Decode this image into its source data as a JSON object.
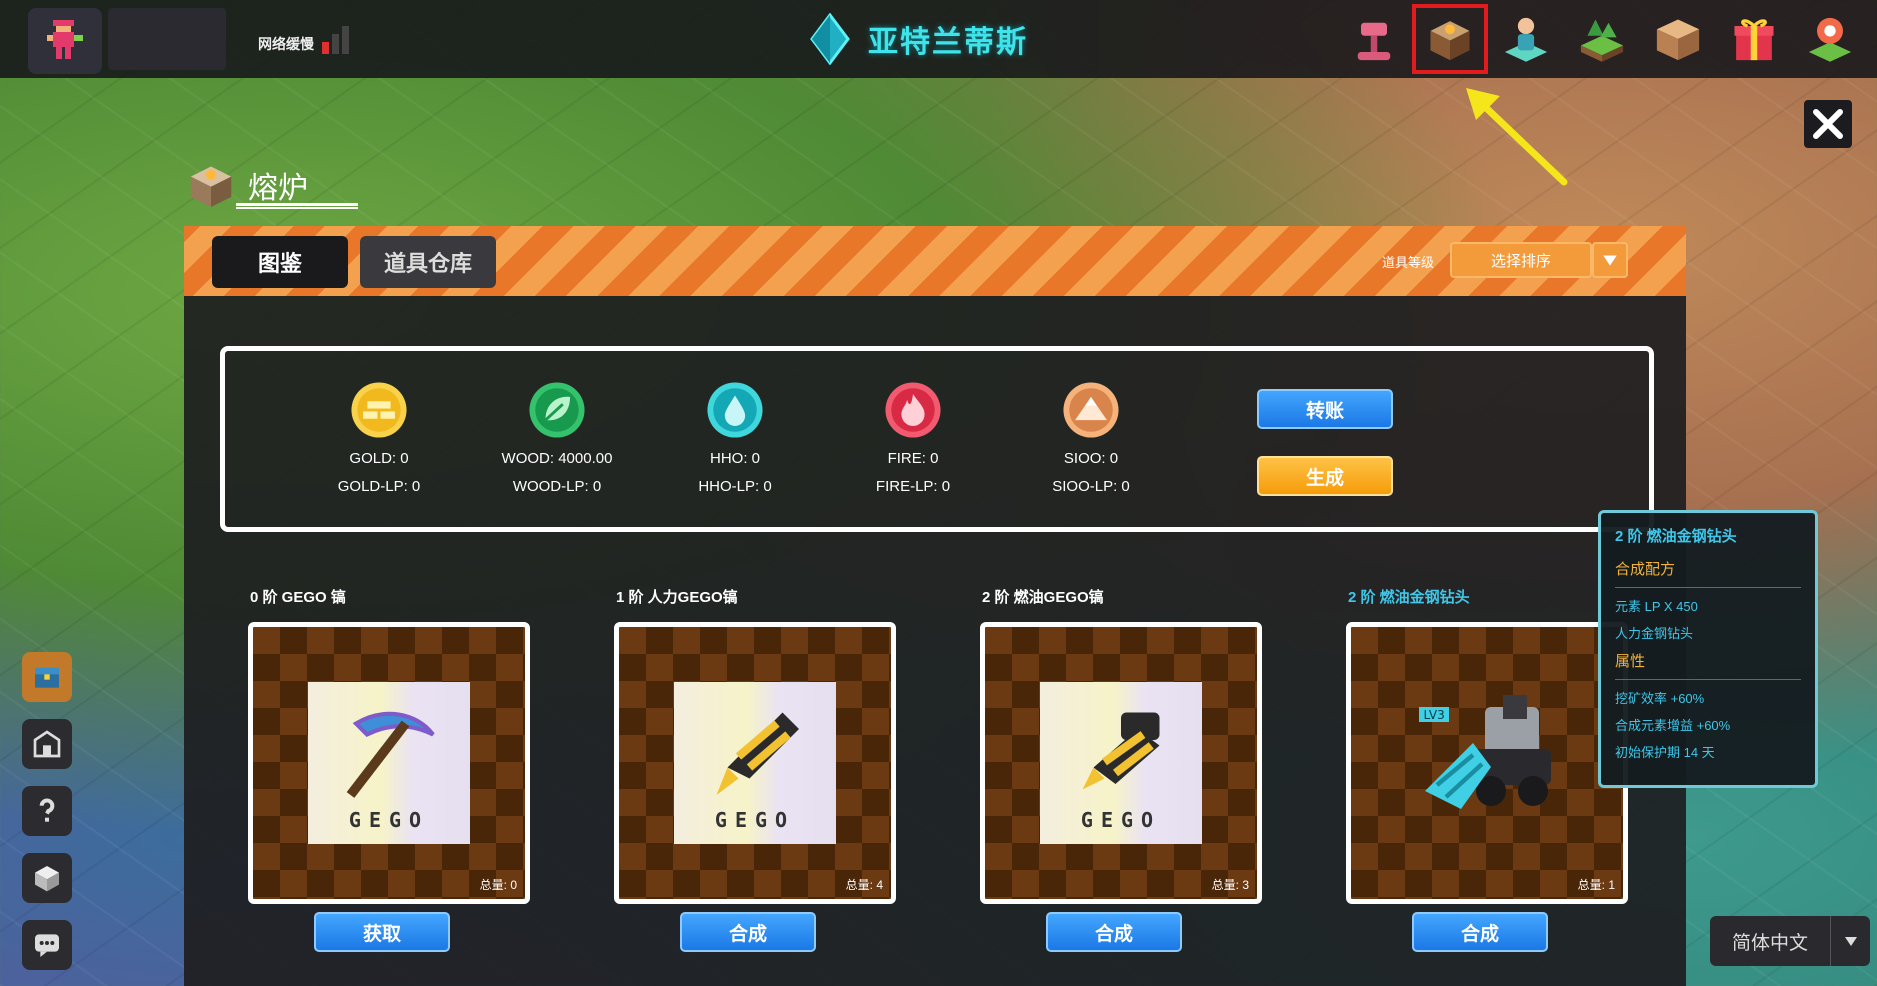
{
  "header": {
    "network_status": "网络缓慢",
    "title": "亚特兰蒂斯",
    "top_icons": [
      "hammer-icon",
      "furnace-icon",
      "character-icon",
      "land-plot-icon",
      "warehouse-icon",
      "gift-icon",
      "map-pin-icon"
    ],
    "highlighted_icon": "furnace-icon"
  },
  "furnace": {
    "title": "熔炉",
    "tabs": [
      "图鉴",
      "道具仓库"
    ],
    "active_tab": "图鉴",
    "sort_label": "道具等级",
    "sort_placeholder": "选择排序"
  },
  "elements": [
    {
      "value": "GOLD: 0",
      "lp": "GOLD-LP: 0",
      "icon": "gold-bars-icon",
      "color": "#f2c230"
    },
    {
      "value": "WOOD: 4000.00",
      "lp": "WOOD-LP: 0",
      "icon": "leaf-icon",
      "color": "#1fa858"
    },
    {
      "value": "HHO: 0",
      "lp": "HHO-LP: 0",
      "icon": "water-drop-icon",
      "color": "#1fb6c2"
    },
    {
      "value": "FIRE: 0",
      "lp": "FIRE-LP: 0",
      "icon": "flame-icon",
      "color": "#e2384f"
    },
    {
      "value": "SIOO: 0",
      "lp": "SIOO-LP: 0",
      "icon": "mountain-icon",
      "color": "#e89a52"
    }
  ],
  "actions": {
    "transfer": "转账",
    "generate": "生成"
  },
  "items": [
    {
      "title": "0 阶 GEGO 镐",
      "brand": "GEGO",
      "count": "总量: 0",
      "button": "获取"
    },
    {
      "title": "1 阶 人力GEGO镐",
      "brand": "GEGO",
      "count": "总量: 4",
      "button": "合成"
    },
    {
      "title": "2 阶 燃油GEGO镐",
      "brand": "GEGO",
      "count": "总量: 3",
      "button": "合成"
    },
    {
      "title": "2 阶 燃油金钢钻头",
      "count": "总量: 1",
      "button": "合成",
      "badge": "LV3"
    }
  ],
  "tooltip": {
    "title": "2 阶 燃油金钢钻头",
    "recipe_label": "合成配方",
    "recipe": [
      "元素 LP X 450",
      "人力金钢钻头"
    ],
    "attr_label": "属性",
    "attrs": [
      "挖矿效率 +60%",
      "合成元素增益 +60%",
      "初始保护期 14 天"
    ]
  },
  "language": "简体中文",
  "colors": {
    "accent_cyan": "#3fc6e8",
    "button_blue": "#1b78e5",
    "button_orange": "#f59c0a",
    "highlight_red": "#e21c1c"
  }
}
